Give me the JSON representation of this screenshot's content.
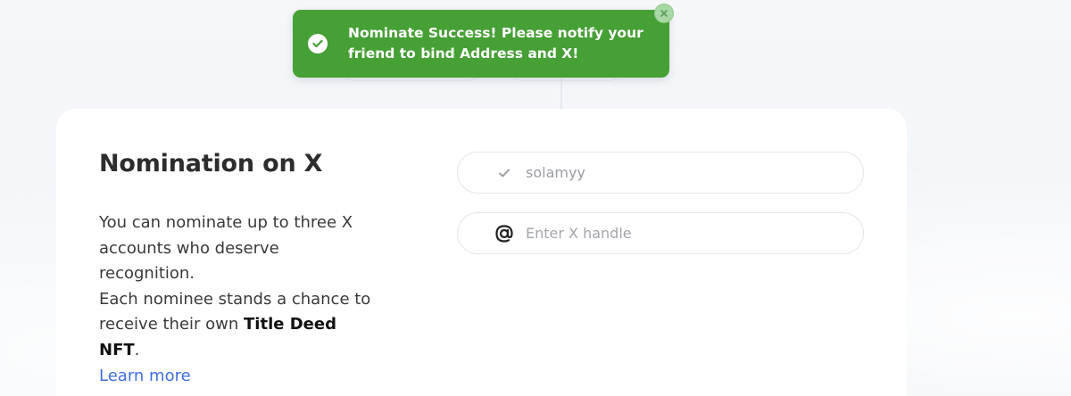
{
  "toast": {
    "message": "Nominate Success! Please notify your friend to bind Address and X!",
    "icon": "check-circle-icon",
    "close_icon": "close-icon",
    "color": "#46a035"
  },
  "card": {
    "title": "Nomination on X",
    "description_1": "You can nominate up to three X accounts who deserve recognition.",
    "description_2a": "Each nominee stands a chance to receive their own ",
    "description_2b": "Title Deed NFT",
    "description_2c": ".",
    "learn_more": "Learn more"
  },
  "inputs": [
    {
      "icon": "checkmark-icon",
      "value": "solamyy"
    },
    {
      "icon": "at-sign-icon",
      "placeholder": "Enter X handle"
    }
  ],
  "colors": {
    "link": "#3f6fdc",
    "title": "#2d2d2d"
  }
}
